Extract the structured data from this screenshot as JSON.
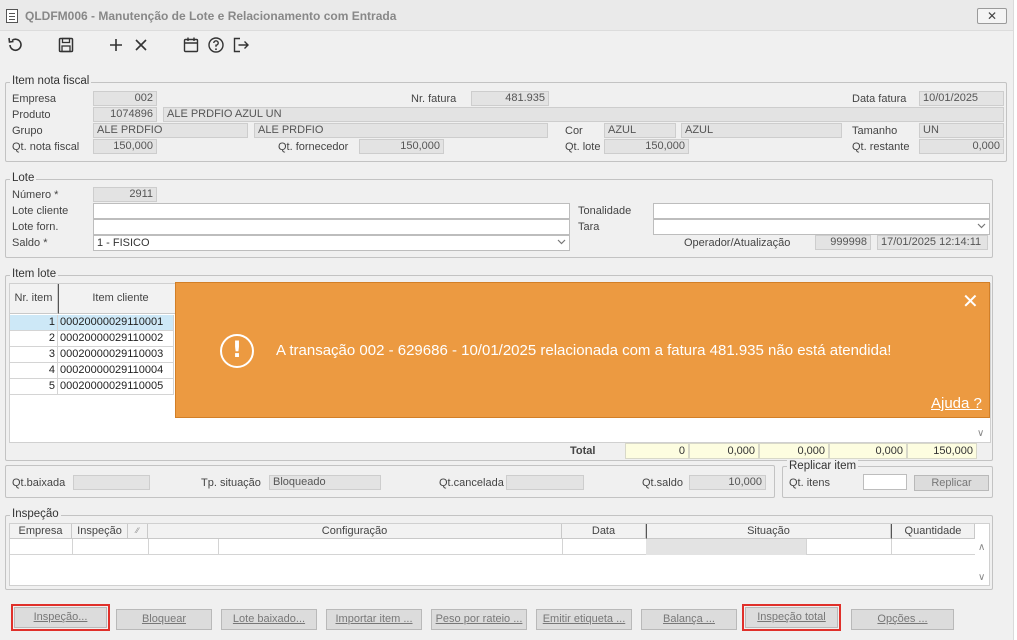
{
  "window": {
    "title": "QLDFM006 - Manutenção de Lote e Relacionamento com Entrada",
    "close_glyph": "✕"
  },
  "toolbar": {
    "icons": [
      "undo-icon",
      "save-icon",
      "add-icon",
      "delete-icon",
      "calendar-icon",
      "help-icon",
      "exit-icon"
    ]
  },
  "item_nota_fiscal": {
    "legend": "Item nota fiscal",
    "empresa_label": "Empresa",
    "empresa": "002",
    "nr_fatura_label": "Nr. fatura",
    "nr_fatura": "481.935",
    "data_fatura_label": "Data fatura",
    "data_fatura": "10/01/2025",
    "produto_label": "Produto",
    "produto_codigo": "1074896",
    "produto_desc": "ALE PRDFIO AZUL UN",
    "grupo_label": "Grupo",
    "grupo_codigo": "ALE PRDFIO",
    "grupo_desc": "ALE PRDFIO",
    "cor_label": "Cor",
    "cor_codigo": "AZUL",
    "cor_desc": "AZUL",
    "tamanho_label": "Tamanho",
    "tamanho": "UN",
    "qt_nota_fiscal_label": "Qt. nota fiscal",
    "qt_nota_fiscal": "150,000",
    "qt_fornecedor_label": "Qt. fornecedor",
    "qt_fornecedor": "150,000",
    "qt_lote_label": "Qt. lote",
    "qt_lote": "150,000",
    "qt_restante_label": "Qt. restante",
    "qt_restante": "0,000"
  },
  "lote": {
    "legend": "Lote",
    "numero_label": "Número *",
    "numero": "2911",
    "lote_cliente_label": "Lote cliente",
    "lote_cliente": "",
    "lote_forn_label": "Lote forn.",
    "lote_forn": "",
    "saldo_label": "Saldo *",
    "saldo": "1 - FISICO",
    "tonalidade_label": "Tonalidade",
    "tonalidade": "",
    "tara_label": "Tara",
    "tara": "",
    "operador_label": "Operador/Atualização",
    "operador": "999998",
    "atualizacao": "17/01/2025 12:14:11"
  },
  "item_lote": {
    "legend": "Item lote",
    "columns": [
      "Nr. item",
      "Item cliente"
    ],
    "rows": [
      {
        "nr": "1",
        "cliente": "00020000029110001"
      },
      {
        "nr": "2",
        "cliente": "00020000029110002"
      },
      {
        "nr": "3",
        "cliente": "00020000029110003"
      },
      {
        "nr": "4",
        "cliente": "00020000029110004"
      },
      {
        "nr": "5",
        "cliente": "00020000029110005"
      }
    ],
    "total_label": "Total",
    "totals": [
      "0",
      "0,000",
      "0,000",
      "0,000",
      "150,000"
    ]
  },
  "status": {
    "qt_baixada_label": "Qt.baixada",
    "qt_baixada": "",
    "tp_situacao_label": "Tp. situação",
    "tp_situacao": "Bloqueado",
    "qt_cancelada_label": "Qt.cancelada",
    "qt_cancelada": "",
    "qt_saldo_label": "Qt.saldo",
    "qt_saldo": "10,000"
  },
  "replicar_item": {
    "legend": "Replicar item",
    "qt_itens_label": "Qt. itens",
    "qt_itens": "",
    "button": "Replicar"
  },
  "inspecao": {
    "legend": "Inspeção",
    "columns": [
      "Empresa",
      "Inspeção",
      "",
      "Configuração",
      "Data",
      "Situação",
      "Quantidade"
    ]
  },
  "buttons": {
    "inspecao": "Inspeção...",
    "bloquear": "Bloquear",
    "lote_baixado": "Lote baixado...",
    "importar_item": "Importar item ...",
    "peso_rateio": "Peso por rateio ...",
    "emitir_etiqueta": "Emitir etiqueta ...",
    "balanca": "Balança ...",
    "inspecao_total": "Inspeção total",
    "opcoes": "Opções ..."
  },
  "toast": {
    "icon": "!",
    "message": "A transação 002 - 629686 - 10/01/2025 relacionada com a fatura 481.935 não está atendida!",
    "help_link": "Ajuda ?",
    "close_glyph": "✕",
    "color": "#ec9a41"
  }
}
